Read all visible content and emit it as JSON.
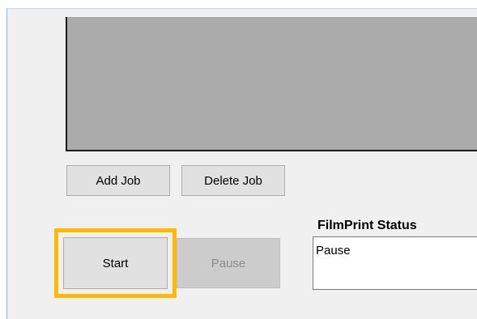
{
  "buttons": {
    "add_job": "Add Job",
    "delete_job": "Delete Job",
    "start": "Start",
    "pause": "Pause"
  },
  "status": {
    "label": "FilmPrint Status",
    "value": "Pause"
  },
  "colors": {
    "highlight": "#ffb900",
    "list_background": "#ababab",
    "window_background": "#f0f0f0"
  }
}
